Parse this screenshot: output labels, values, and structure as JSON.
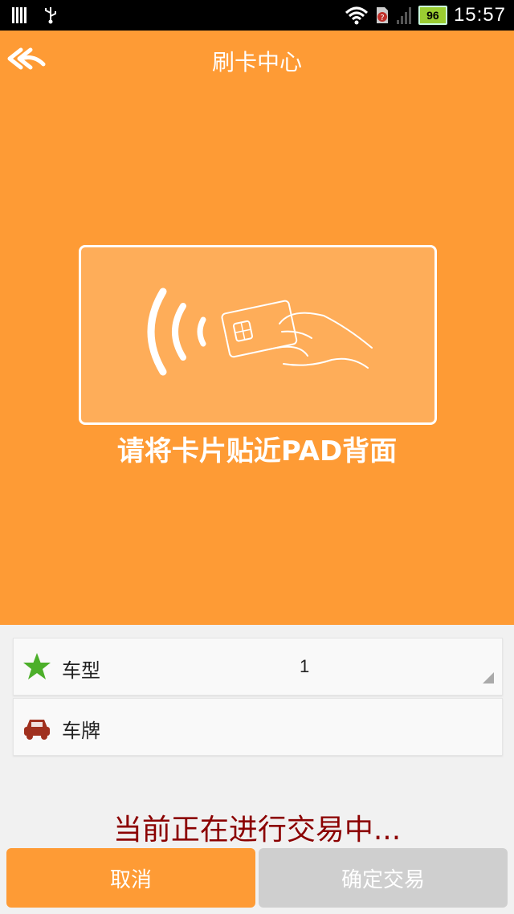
{
  "status_bar": {
    "time": "15:57",
    "battery": "96",
    "icons": [
      "signal-bars-icon",
      "usb-icon",
      "wifi-icon",
      "sim-alert-icon",
      "cell-signal-icon",
      "battery-icon"
    ]
  },
  "header": {
    "title": "刷卡中心",
    "back_icon": "back-arrow-icon"
  },
  "card_area": {
    "prompt": "请将卡片贴近PAD背面"
  },
  "form": {
    "fields": [
      {
        "icon": "star-icon",
        "label": "车型",
        "value": "1",
        "has_dropdown": true
      },
      {
        "icon": "car-icon",
        "label": "车牌",
        "value": ""
      }
    ]
  },
  "status_text": "当前正在进行交易中...",
  "buttons": {
    "cancel": "取消",
    "confirm": "确定交易"
  },
  "colors": {
    "accent": "#fe9b35",
    "status_text": "#8b0000",
    "disabled_button": "#cfcfcf"
  }
}
